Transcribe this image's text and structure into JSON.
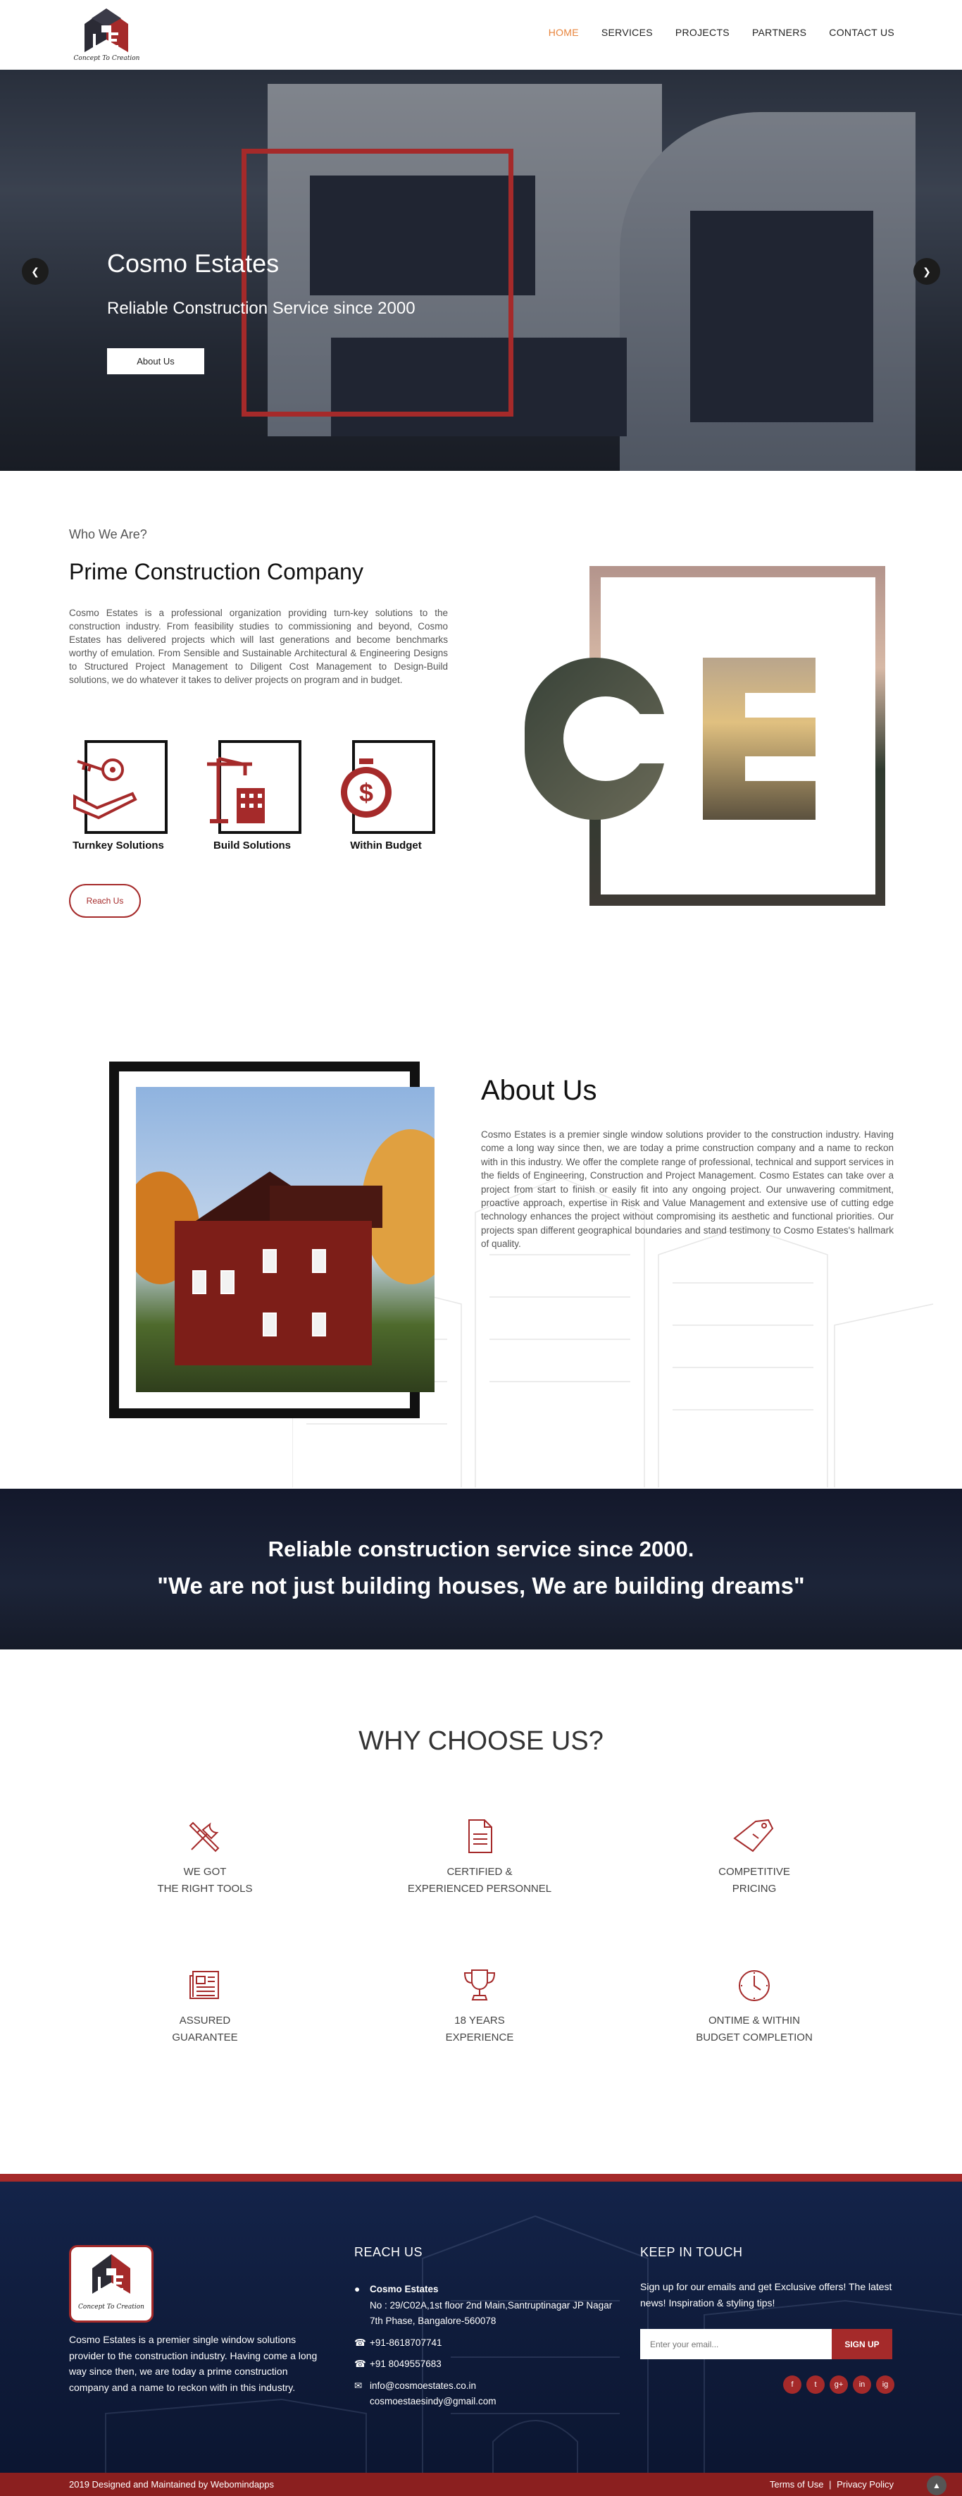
{
  "brand": {
    "tagline": "Concept To Creation",
    "accent": "#a52a2a",
    "nav_active": "#e8843c"
  },
  "nav": {
    "items": [
      {
        "label": "HOME",
        "active": true
      },
      {
        "label": "SERVICES",
        "active": false
      },
      {
        "label": "PROJECTS",
        "active": false
      },
      {
        "label": "PARTNERS",
        "active": false
      },
      {
        "label": "CONTACT US",
        "active": false
      }
    ]
  },
  "hero": {
    "title": "Cosmo Estates",
    "subtitle": "Reliable Construction Service since 2000",
    "button": "About Us",
    "prev_icon": "chevron-left-icon",
    "next_icon": "chevron-right-icon"
  },
  "who": {
    "eyebrow": "Who We Are?",
    "title": "Prime Construction Company",
    "text": "Cosmo Estates is a professional organization providing turn-key solutions to the construction industry. From feasibility studies to commissioning and beyond, Cosmo Estates has delivered projects which will last generations and become benchmarks worthy of emulation. From Sensible and Sustainable Architectural & Engineering Designs to Structured Project Management to Diligent Cost Management to Design-Build solutions, we do whatever it takes to deliver projects on program and in budget.",
    "features": [
      {
        "label": "Turnkey Solutions",
        "icon": "key-hand-icon"
      },
      {
        "label": "Build Solutions",
        "icon": "crane-building-icon"
      },
      {
        "label": "Within Budget",
        "icon": "dollar-stopwatch-icon"
      }
    ],
    "button": "Reach Us"
  },
  "about": {
    "title": "About Us",
    "text": "Cosmo Estates is a premier single window solutions provider to the construction industry. Having come a long way since then, we are today a prime construction company and a name to reckon with in this industry. We offer the complete range of professional, technical and support services in the fields of Engineering, Construction and Project Management. Cosmo Estates can take over a project from start to finish or easily fit into any ongoing project. Our unwavering commitment, proactive approach, expertise in Risk and Value Management and extensive use of cutting edge technology enhances the project without compromising its aesthetic and functional priorities. Our projects span different geographical boundaries and stand testimony to Cosmo Estates's hallmark of quality."
  },
  "band": {
    "line1": "Reliable construction service since 2000.",
    "line2": "\"We are not just building houses, We are building dreams\""
  },
  "why": {
    "title": "WHY CHOOSE US?",
    "items": [
      {
        "line1": "WE GOT",
        "line2": "THE RIGHT TOOLS",
        "icon": "tools-icon"
      },
      {
        "line1": "CERTIFIED &",
        "line2": "EXPERIENCED PERSONNEL",
        "icon": "document-icon"
      },
      {
        "line1": "COMPETITIVE",
        "line2": "PRICING",
        "icon": "price-tag-icon"
      },
      {
        "line1": "ASSURED",
        "line2": "GUARANTEE",
        "icon": "newspaper-icon"
      },
      {
        "line1": "18 YEARS",
        "line2": "EXPERIENCE",
        "icon": "trophy-icon"
      },
      {
        "line1": "ONTIME & WITHIN",
        "line2": "BUDGET COMPLETION",
        "icon": "clock-icon"
      }
    ]
  },
  "footer": {
    "about_text": "Cosmo Estates is a premier single window solutions provider to the construction industry. Having come a long way since then, we are today a prime construction company and a name to reckon with in this industry.",
    "reach_heading": "REACH US",
    "company": "Cosmo Estates",
    "address": "No : 29/C02A,1st floor 2nd Main,Santruptinagar JP Nagar 7th Phase, Bangalore-560078",
    "phone1": "+91-8618707741",
    "phone2": "+91 8049557683",
    "email1": "info@cosmoestates.co.in",
    "email2": "cosmoestaesindy@gmail.com",
    "keep_heading": "KEEP IN TOUCH",
    "keep_text": "Sign up for our emails and get Exclusive offers! The latest news! Inspiration & styling tips!",
    "email_placeholder": "Enter your email...",
    "signup": "SIGN UP",
    "socials": [
      "f",
      "t",
      "g+",
      "in",
      "ig"
    ],
    "copyright": "2019 Designed and Maintained by Webomindapps",
    "terms": "Terms of Use",
    "separator": "|",
    "privacy": "Privacy Policy"
  }
}
